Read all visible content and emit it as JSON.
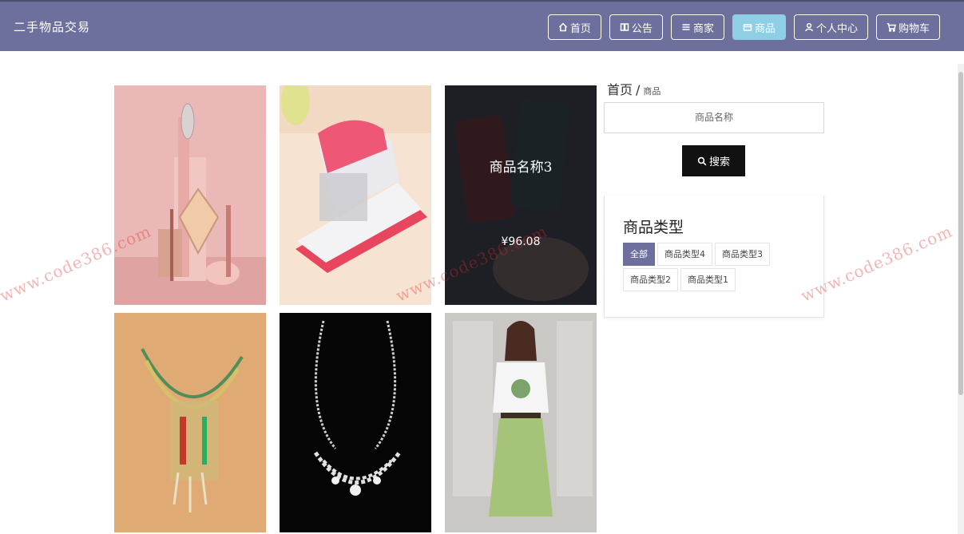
{
  "header": {
    "brand": "二手物品交易",
    "nav": [
      {
        "label": "首页",
        "icon": "home-icon"
      },
      {
        "label": "公告",
        "icon": "notice-icon"
      },
      {
        "label": "商家",
        "icon": "list-icon"
      },
      {
        "label": "商品",
        "icon": "goods-icon",
        "active": true
      },
      {
        "label": "个人中心",
        "icon": "user-icon"
      },
      {
        "label": "购物车",
        "icon": "cart-icon"
      }
    ]
  },
  "breadcrumb": {
    "home": "首页",
    "separator": "/",
    "current": "商品"
  },
  "search": {
    "placeholder": "商品名称",
    "button": "搜索"
  },
  "categories": {
    "title": "商品类型",
    "tags": [
      {
        "label": "全部",
        "active": true
      },
      {
        "label": "商品类型4"
      },
      {
        "label": "商品类型3"
      },
      {
        "label": "商品类型2"
      },
      {
        "label": "商品类型1"
      }
    ]
  },
  "products": [
    {
      "image": "cosmetics-product-image"
    },
    {
      "image": "stapler-product-image"
    },
    {
      "image": "phone-product-image",
      "name": "商品名称3",
      "price": "¥96.08",
      "hovered": true
    },
    {
      "image": "gold-necklace-product-image"
    },
    {
      "image": "diamond-necklace-product-image"
    },
    {
      "image": "dress-product-image"
    }
  ],
  "watermark": "www.code386.com",
  "colors": {
    "header": "#6d6f9c",
    "active_nav": "#8fcfe6",
    "search_button": "#111111",
    "active_tag": "#6d6f9c"
  }
}
